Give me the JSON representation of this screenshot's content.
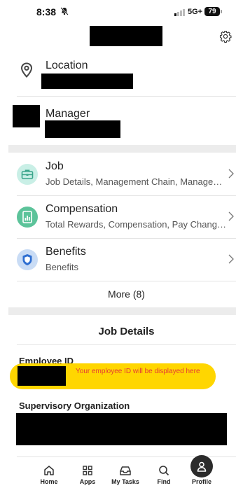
{
  "status_bar": {
    "time": "8:38",
    "network": "5G+",
    "battery": "79"
  },
  "profile": {
    "location_label": "Location",
    "manager_label": "Manager"
  },
  "nav_list": [
    {
      "title": "Job",
      "subtitle": "Job Details, Management Chain, Management Chain, Job History",
      "icon": "briefcase-icon",
      "color": "#c9efe6",
      "icon_color": "#3aa58b"
    },
    {
      "title": "Compensation",
      "subtitle": "Total Rewards, Compensation, Pay Change History",
      "icon": "document-chart-icon",
      "color": "#5cc39a",
      "icon_color": "#ffffff"
    },
    {
      "title": "Benefits",
      "subtitle": "Benefits",
      "icon": "shield-icon",
      "color": "#c9dcf5",
      "icon_color": "#2f6fd1"
    }
  ],
  "more_label": "More (8)",
  "job_details": {
    "heading": "Job Details",
    "employee_id_label": "Employee ID",
    "employee_id_note": "Your employee ID will be displayed here",
    "supervisory_org_label": "Supervisory Organization"
  },
  "bottom_nav": [
    {
      "label": "Home",
      "icon": "home-icon"
    },
    {
      "label": "Apps",
      "icon": "apps-grid-icon"
    },
    {
      "label": "My Tasks",
      "icon": "inbox-tray-icon"
    },
    {
      "label": "Find",
      "icon": "search-icon"
    },
    {
      "label": "Profile",
      "icon": "person-icon"
    }
  ]
}
